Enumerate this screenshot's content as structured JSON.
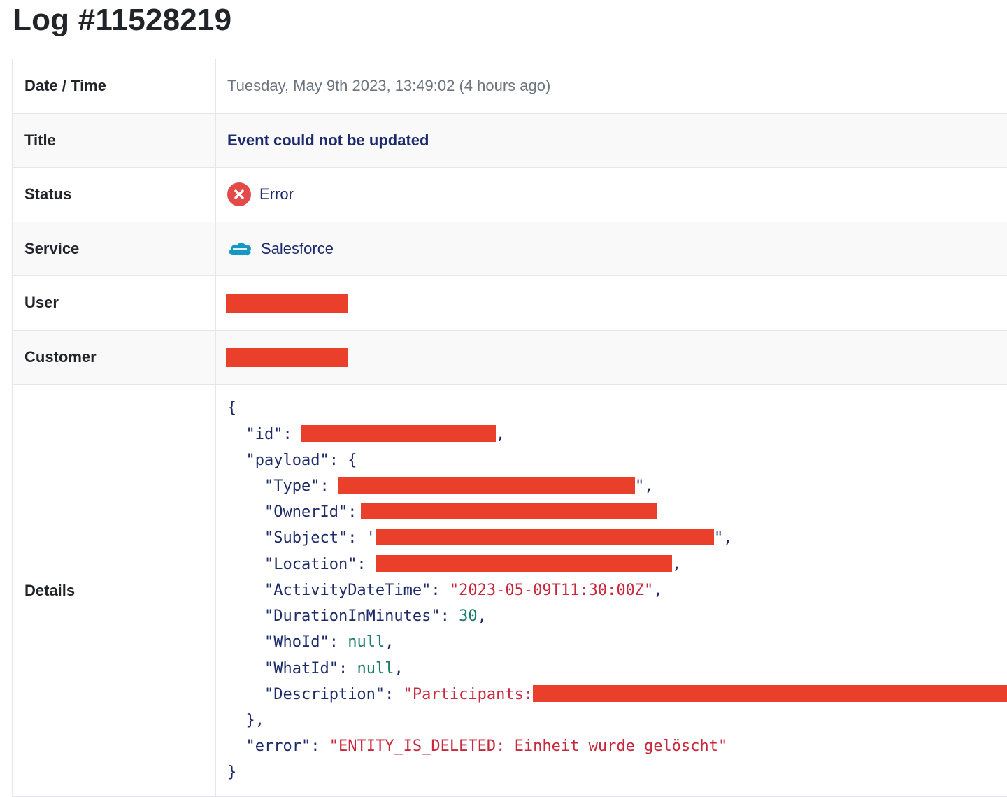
{
  "page": {
    "title": "Log #11528219"
  },
  "rows": {
    "datetime": {
      "label": "Date / Time",
      "value": "Tuesday, May 9th 2023, 13:49:02 (4 hours ago)"
    },
    "title": {
      "label": "Title",
      "value": "Event could not be updated"
    },
    "status": {
      "label": "Status",
      "value": "Error",
      "icon": "error-x-icon",
      "icon_color": "#e34b4b"
    },
    "service": {
      "label": "Service",
      "value": "Salesforce",
      "icon": "salesforce-icon",
      "icon_color": "#1798c1"
    },
    "user": {
      "label": "User",
      "value_redacted": true
    },
    "customer": {
      "label": "Customer",
      "value_redacted": true
    },
    "details": {
      "label": "Details",
      "json": {
        "open_brace": "{",
        "id_key": "\"id\":",
        "payload_key": "\"payload\": {",
        "type_key": "\"Type\":",
        "ownerid_key": "\"OwnerId\":",
        "subject_key": "\"Subject\":",
        "location_key": "\"Location\":",
        "activity_key": "\"ActivityDateTime\":",
        "activity_value": "\"2023-05-09T11:30:00Z\"",
        "duration_key": "\"DurationInMinutes\":",
        "duration_value": "30",
        "whoid_key": "\"WhoId\":",
        "whoid_value": "null",
        "whatid_key": "\"WhatId\":",
        "whatid_value": "null",
        "description_key": "\"Description\":",
        "description_value": "\"Participants:",
        "payload_close": "},",
        "error_key": "\"error\":",
        "error_value": "\"ENTITY_IS_DELETED: Einheit wurde gelöscht\"",
        "close_brace": "}"
      }
    }
  },
  "colors": {
    "redaction": "#ea3f2a",
    "json_string": "#c8283c",
    "json_number": "#1a7c6c",
    "json_key": "#1d2b6b"
  }
}
